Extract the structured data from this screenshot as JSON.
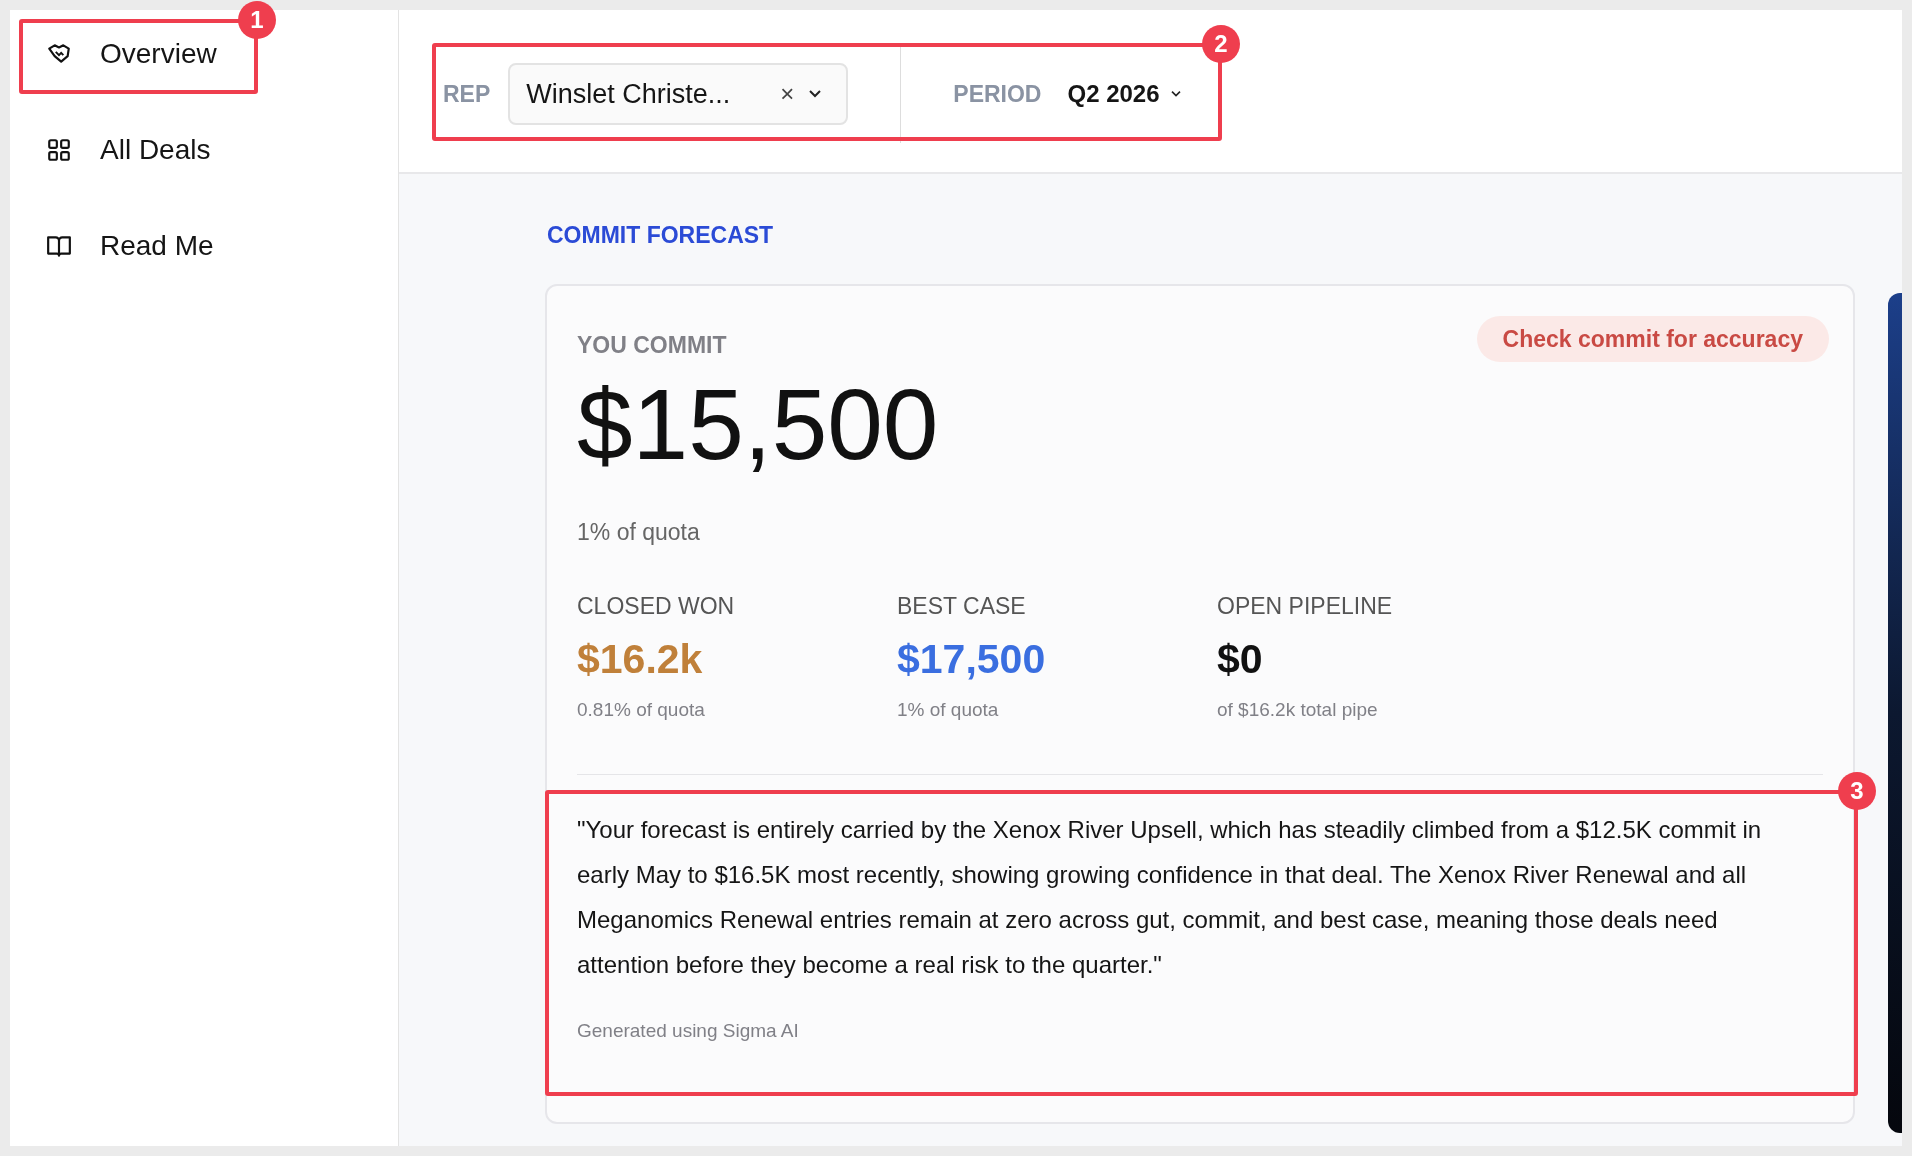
{
  "sidebar": {
    "items": [
      {
        "label": "Overview"
      },
      {
        "label": "All Deals"
      },
      {
        "label": "Read Me"
      }
    ]
  },
  "filters": {
    "rep": {
      "label": "REP",
      "value": "Winslet Christe...",
      "clear": "×"
    },
    "period": {
      "label": "PERIOD",
      "value": "Q2 2026"
    }
  },
  "forecast": {
    "title": "COMMIT FORECAST",
    "commit_label": "YOU COMMIT",
    "commit_value": "$15,500",
    "commit_note": "1% of quota",
    "check_button": "Check commit for accuracy",
    "stats": [
      {
        "label": "CLOSED WON",
        "value": "$16.2k",
        "note": "0.81% of quota",
        "color": "#c0803a"
      },
      {
        "label": "BEST CASE",
        "value": "$17,500",
        "note": "1% of quota",
        "color": "#3a6ee0"
      },
      {
        "label": "OPEN PIPELINE",
        "value": "$0",
        "note": "of $16.2k total pipe",
        "color": "#111111"
      }
    ],
    "summary": "\"Your forecast is entirely carried by the Xenox River Upsell, which has steadily climbed from a $12.5K commit in early May to $16.5K most recently, showing growing confidence in that deal. The Xenox River Renewal and all Meganomics Renewal entries remain at zero across gut, commit, and best case, meaning those deals need attention before they become a real risk to the quarter.\"",
    "footnote": "Generated using Sigma AI"
  },
  "callouts": [
    {
      "number": "1"
    },
    {
      "number": "2"
    },
    {
      "number": "3"
    }
  ]
}
